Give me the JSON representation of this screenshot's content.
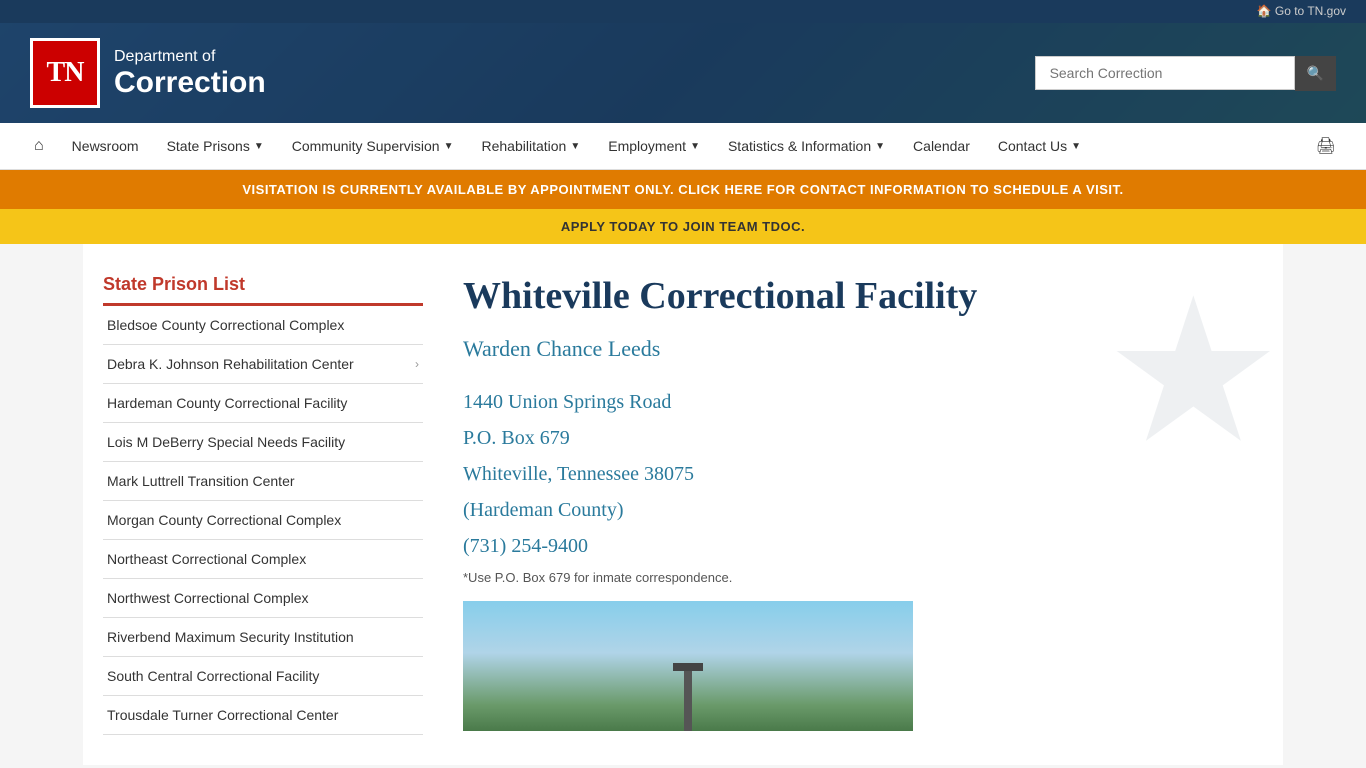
{
  "topbar": {
    "go_to_tn": "🏠 Go to TN.gov"
  },
  "header": {
    "logo_text": "TN",
    "dept_of": "Department of",
    "dept_correction": "Correction",
    "search_placeholder": "Search Correction"
  },
  "nav": {
    "home_icon": "⌂",
    "items": [
      {
        "label": "Newsroom",
        "has_dropdown": false
      },
      {
        "label": "State Prisons",
        "has_dropdown": true
      },
      {
        "label": "Community Supervision",
        "has_dropdown": true
      },
      {
        "label": "Rehabilitation",
        "has_dropdown": true
      },
      {
        "label": "Employment",
        "has_dropdown": true
      },
      {
        "label": "Statistics & Information",
        "has_dropdown": true
      },
      {
        "label": "Calendar",
        "has_dropdown": false
      },
      {
        "label": "Contact Us",
        "has_dropdown": true
      }
    ]
  },
  "banners": {
    "orange_text": "VISITATION IS CURRENTLY AVAILABLE BY APPOINTMENT ONLY. CLICK HERE FOR CONTACT INFORMATION TO SCHEDULE A VISIT.",
    "yellow_text": "APPLY TODAY TO JOIN TEAM TDOC."
  },
  "sidebar": {
    "title": "State Prison List",
    "items": [
      {
        "label": "Bledsoe County Correctional Complex",
        "has_expand": false
      },
      {
        "label": "Debra K. Johnson Rehabilitation Center",
        "has_expand": true
      },
      {
        "label": "Hardeman County Correctional Facility",
        "has_expand": false
      },
      {
        "label": "Lois M DeBerry Special Needs Facility",
        "has_expand": false
      },
      {
        "label": "Mark Luttrell Transition Center",
        "has_expand": false
      },
      {
        "label": "Morgan County Correctional Complex",
        "has_expand": false
      },
      {
        "label": "Northeast Correctional Complex",
        "has_expand": false
      },
      {
        "label": "Northwest Correctional Complex",
        "has_expand": false
      },
      {
        "label": "Riverbend Maximum Security Institution",
        "has_expand": false
      },
      {
        "label": "South Central Correctional Facility",
        "has_expand": false
      },
      {
        "label": "Trousdale Turner Correctional Center",
        "has_expand": false
      }
    ]
  },
  "detail": {
    "facility_name": "Whiteville Correctional Facility",
    "warden": "Warden Chance Leeds",
    "address_line1": "1440 Union Springs Road",
    "address_line2": "P.O. Box 679",
    "address_line3": "Whiteville, Tennessee 38075",
    "address_line4": "(Hardeman County)",
    "phone": "(731) 254-9400",
    "inmate_note": "*Use P.O. Box 679 for inmate correspondence."
  }
}
